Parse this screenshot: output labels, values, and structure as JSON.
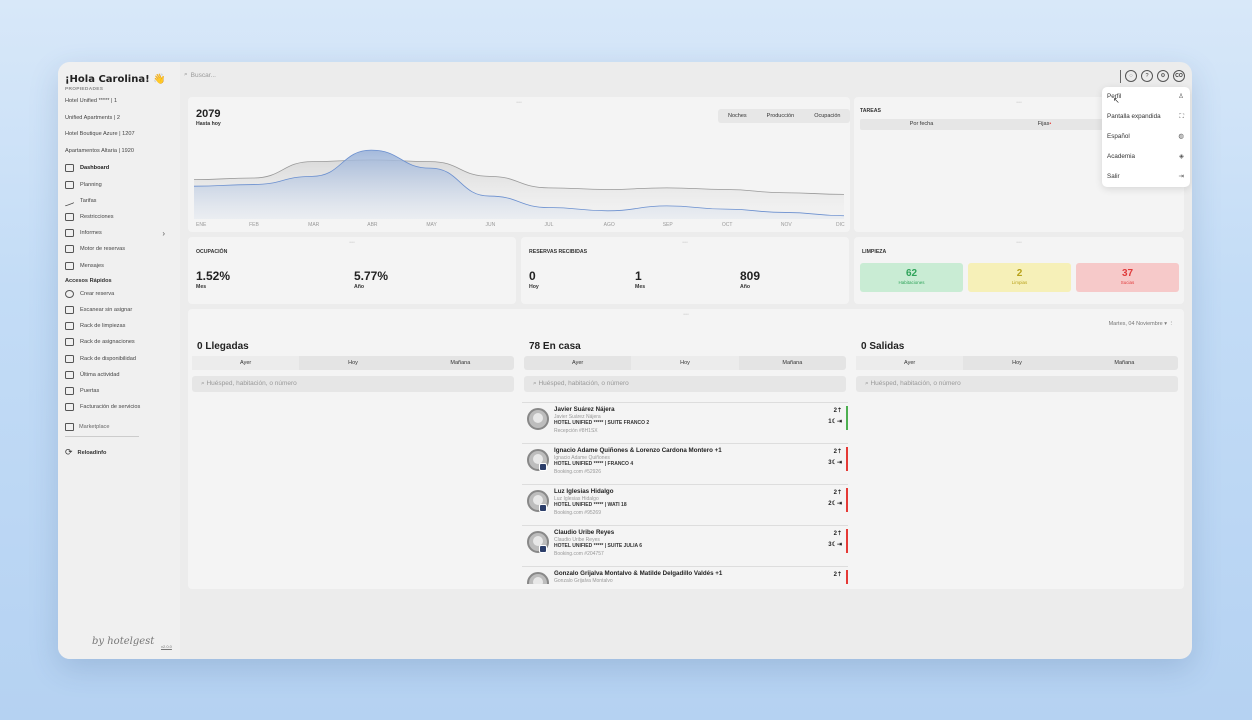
{
  "sidebar": {
    "greeting": "¡Hola Carolina! 👋",
    "properties_title": "PROPIEDADES",
    "properties": [
      "Hotel Unified ***** | 1",
      "Unified Apartments | 2",
      "Hotel Boutique Azure | 1207",
      "Apartamentos Altaria | 1920"
    ],
    "nav": [
      {
        "label": "Dashboard",
        "icon": "dashboard-icon",
        "active": true
      },
      {
        "label": "Planning",
        "icon": "calendar-icon"
      },
      {
        "label": "Tarifas",
        "icon": "trend-icon"
      },
      {
        "label": "Restricciones",
        "icon": "lock-icon"
      },
      {
        "label": "Informes",
        "icon": "report-icon"
      },
      {
        "label": "Motor de reservas",
        "icon": "engine-icon"
      },
      {
        "label": "Mensajes",
        "icon": "message-icon"
      }
    ],
    "quick_title": "Accesos Rápidos",
    "quick": [
      {
        "label": "Crear reserva",
        "icon": "add-circle-icon"
      },
      {
        "label": "Escanear sin asignar",
        "icon": "scan-icon"
      },
      {
        "label": "Rack de limpiezas",
        "icon": "broom-icon"
      },
      {
        "label": "Rack de asignaciones",
        "icon": "assign-icon"
      },
      {
        "label": "Rack de disponibilidad",
        "icon": "availability-icon"
      },
      {
        "label": "Última actividad",
        "icon": "activity-icon"
      },
      {
        "label": "Puertas",
        "icon": "key-icon"
      },
      {
        "label": "Facturación de servicios",
        "icon": "invoice-icon"
      }
    ],
    "marketplace": "Marketplace",
    "reload": "Reloadinfo",
    "brand": "by hotelgest",
    "version": "v2.0.0"
  },
  "search": {
    "placeholder": "Buscar..."
  },
  "header_icons": {
    "bell": "◌",
    "help": "?",
    "settings": "⚙",
    "avatar": "CO"
  },
  "production": {
    "value": "2079",
    "label": "Hasta hoy",
    "tabs": [
      "Noches",
      "Producción",
      "Ocupación"
    ],
    "months": [
      "ENE",
      "FEB",
      "MAR",
      "ABR",
      "MAY",
      "JUN",
      "JUL",
      "AGO",
      "SEP",
      "OCT",
      "NOV",
      "DIC"
    ]
  },
  "chart_data": {
    "type": "area",
    "categories": [
      "ENE",
      "FEB",
      "MAR",
      "ABR",
      "MAY",
      "JUN",
      "JUL",
      "AGO",
      "SEP",
      "OCT",
      "NOV",
      "DIC"
    ],
    "series": [
      {
        "values": [
          48,
          50,
          70,
          72,
          70,
          52,
          38,
          36,
          38,
          36,
          32,
          30
        ]
      },
      {
        "values": [
          40,
          42,
          52,
          84,
          62,
          28,
          14,
          10,
          16,
          12,
          8,
          4
        ]
      }
    ]
  },
  "tasks": {
    "title": "TAREAS",
    "columns": [
      "Por fecha",
      "Fijas"
    ]
  },
  "occupancy": {
    "title": "OCUPACIÓN",
    "month_value": "1.52%",
    "month_label": "Mes",
    "year_value": "5.77%",
    "year_label": "Año"
  },
  "bookings": {
    "title": "RESERVAS RECIBIDAS",
    "today_value": "0",
    "today_label": "Hoy",
    "month_value": "1",
    "month_label": "Mes",
    "year_value": "809",
    "year_label": "Año"
  },
  "cleaning": {
    "title": "LIMPIEZA",
    "items": [
      {
        "value": "62",
        "label": "Habitaciones",
        "bg": "#c9ecd4",
        "color": "#2fa35a"
      },
      {
        "value": "2",
        "label": "Limpias",
        "bg": "#f6f0b8",
        "color": "#b8a21a"
      },
      {
        "value": "37",
        "label": "Sucias",
        "bg": "#f6c9c9",
        "color": "#e03a3a"
      }
    ]
  },
  "date_picker": {
    "label": "Martes, 04 Noviembre"
  },
  "arrivals": {
    "title": "0 Llegadas",
    "tabs": [
      "Ayer",
      "Hoy",
      "Mañana"
    ],
    "search": "Huésped, habitación, o número"
  },
  "inhouse": {
    "title": "78 En casa",
    "tabs": [
      "Ayer",
      "Hoy",
      "Mañana"
    ],
    "search": "Huésped, habitación, o número",
    "guests": [
      {
        "name": "Javier Suárez Nájera",
        "sub": "Javier Suárez Nájera",
        "hotel": "HOTEL UNIFIED ***** | SUITE FRANCO 2",
        "source": "Recepción #8H1SX",
        "pax": "2",
        "nights": "1",
        "bar": "#4caf50",
        "badge": false
      },
      {
        "name": "Ignacio Adame Quiñones & Lorenzo Cardona Montero +1",
        "sub": "Ignacio Adame Quiñones",
        "hotel": "HOTEL UNIFIED ***** | FRANCO 4",
        "source": "Booking.com #52926",
        "pax": "2",
        "nights": "3",
        "bar": "#e53935",
        "badge": true
      },
      {
        "name": "Luz Iglesias Hidalgo",
        "sub": "Luz Iglesias Hidalgo",
        "hotel": "HOTEL UNIFIED ***** | WATI 18",
        "source": "Booking.com #95269",
        "pax": "2",
        "nights": "2",
        "bar": "#e53935",
        "badge": true
      },
      {
        "name": "Claudio Uribe Reyes",
        "sub": "Claudio Uribe Reyes",
        "hotel": "HOTEL UNIFIED ***** | SUITE JULIA 6",
        "source": "Booking.com #204757",
        "pax": "2",
        "nights": "3",
        "bar": "#e53935",
        "badge": true
      },
      {
        "name": "Gonzalo Grijalva Montalvo & Matilde Delgadillo Valdés +1",
        "sub": "Gonzalo Grijalva Montalvo",
        "hotel": "",
        "source": "",
        "pax": "2",
        "nights": "",
        "bar": "#e53935",
        "badge": false
      }
    ]
  },
  "departures": {
    "title": "0 Salidas",
    "tabs": [
      "Ayer",
      "Hoy",
      "Mañana"
    ],
    "search": "Huésped, habitación, o número"
  },
  "profile_menu": {
    "items": [
      {
        "label": "Perfil",
        "icon": "user-icon",
        "glyph": "♙"
      },
      {
        "label": "Pantalla expandida",
        "icon": "expand-icon",
        "glyph": "⛶"
      },
      {
        "label": "Español",
        "icon": "globe-icon",
        "glyph": "◍"
      },
      {
        "label": "Academia",
        "icon": "academy-icon",
        "glyph": "◈"
      },
      {
        "label": "Salir",
        "icon": "logout-icon",
        "glyph": "⇥"
      }
    ]
  }
}
